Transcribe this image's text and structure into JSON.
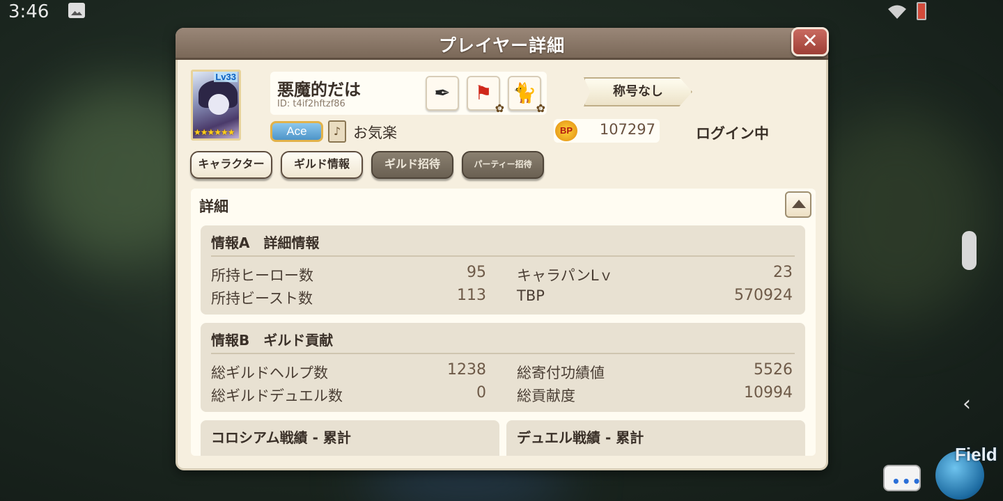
{
  "status_bar": {
    "time": "3:46"
  },
  "dialog": {
    "title": "プレイヤー詳細",
    "close_label": "✕"
  },
  "player": {
    "level_badge": "Lv33",
    "stars": "★★★★★★",
    "name": "悪魔的だは",
    "id": "ID: t4if2hftzf86",
    "rank": "Ace",
    "status": "お気楽",
    "title_badge": "称号なし",
    "bp_label": "BP",
    "bp_value": "107297",
    "login_status": "ログイン中"
  },
  "icon_buttons": [
    {
      "name": "quill-icon",
      "glyph": "✒"
    },
    {
      "name": "flag-icon",
      "glyph": "⚑"
    },
    {
      "name": "cat-icon",
      "glyph": "🐈"
    }
  ],
  "tabs": [
    {
      "label": "キャラクター",
      "style": "light"
    },
    {
      "label": "ギルド情報",
      "style": "light"
    },
    {
      "label": "ギルド招待",
      "style": "dark"
    },
    {
      "label": "パーティー招待",
      "style": "dark"
    }
  ],
  "details": {
    "title": "詳細",
    "section_a": {
      "title": "情報A　詳細情報",
      "stats": [
        {
          "label": "所持ヒーロー数",
          "value": "95"
        },
        {
          "label": "キャラパンLｖ",
          "value": "23"
        },
        {
          "label": "所持ビースト数",
          "value": "113"
        },
        {
          "label": "TBP",
          "value": "570924"
        }
      ]
    },
    "section_b": {
      "title": "情報B　ギルド貢献",
      "stats": [
        {
          "label": "総ギルドヘルプ数",
          "value": "1238"
        },
        {
          "label": "総寄付功績値",
          "value": "5526"
        },
        {
          "label": "総ギルドデュエル数",
          "value": "0"
        },
        {
          "label": "総貢献度",
          "value": "10994"
        }
      ]
    },
    "colosseum_title": "コロシアム戦績 - 累計",
    "duel_title": "デュエル戦績 - 累計"
  },
  "hud": {
    "field_label": "Field",
    "chat_glyph": "•••"
  }
}
